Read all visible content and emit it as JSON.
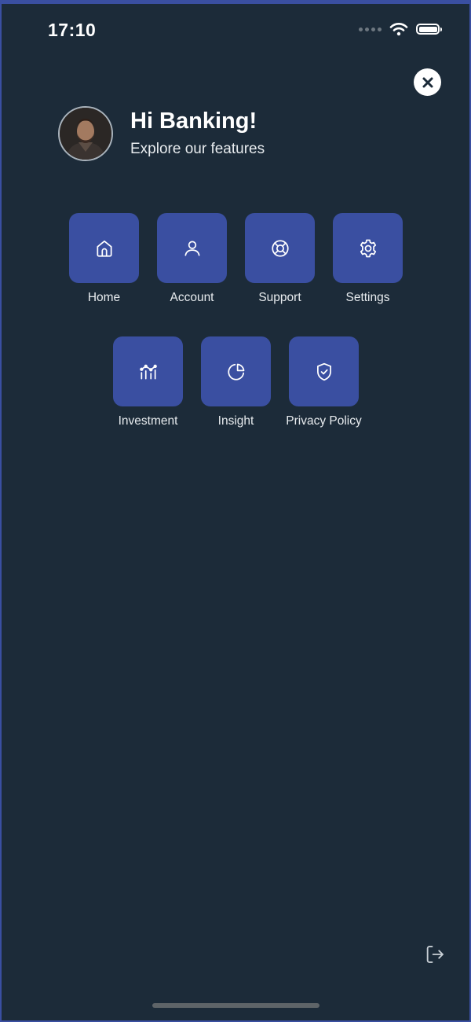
{
  "status_bar": {
    "time": "17:10",
    "icons": [
      "signal-dots-icon",
      "wifi-icon",
      "battery-icon"
    ]
  },
  "header": {
    "greeting": "Hi Banking!",
    "subtitle": "Explore our features",
    "avatar": "user-avatar-photo"
  },
  "close_button": {
    "icon": "close-icon"
  },
  "menu": {
    "items": [
      {
        "label": "Home",
        "icon": "home-icon"
      },
      {
        "label": "Account",
        "icon": "user-icon"
      },
      {
        "label": "Support",
        "icon": "lifebuoy-icon"
      },
      {
        "label": "Settings",
        "icon": "gear-icon"
      },
      {
        "label": "Investment",
        "icon": "investment-chart-icon"
      },
      {
        "label": "Insight",
        "icon": "pie-chart-icon"
      },
      {
        "label": "Privacy Policy",
        "icon": "shield-check-icon"
      }
    ]
  },
  "footer": {
    "logout_icon": "logout-icon"
  },
  "colors": {
    "background": "#1c2b39",
    "tile": "#3a4fa1",
    "frame": "#3a4fa1",
    "text": "#ffffff"
  }
}
